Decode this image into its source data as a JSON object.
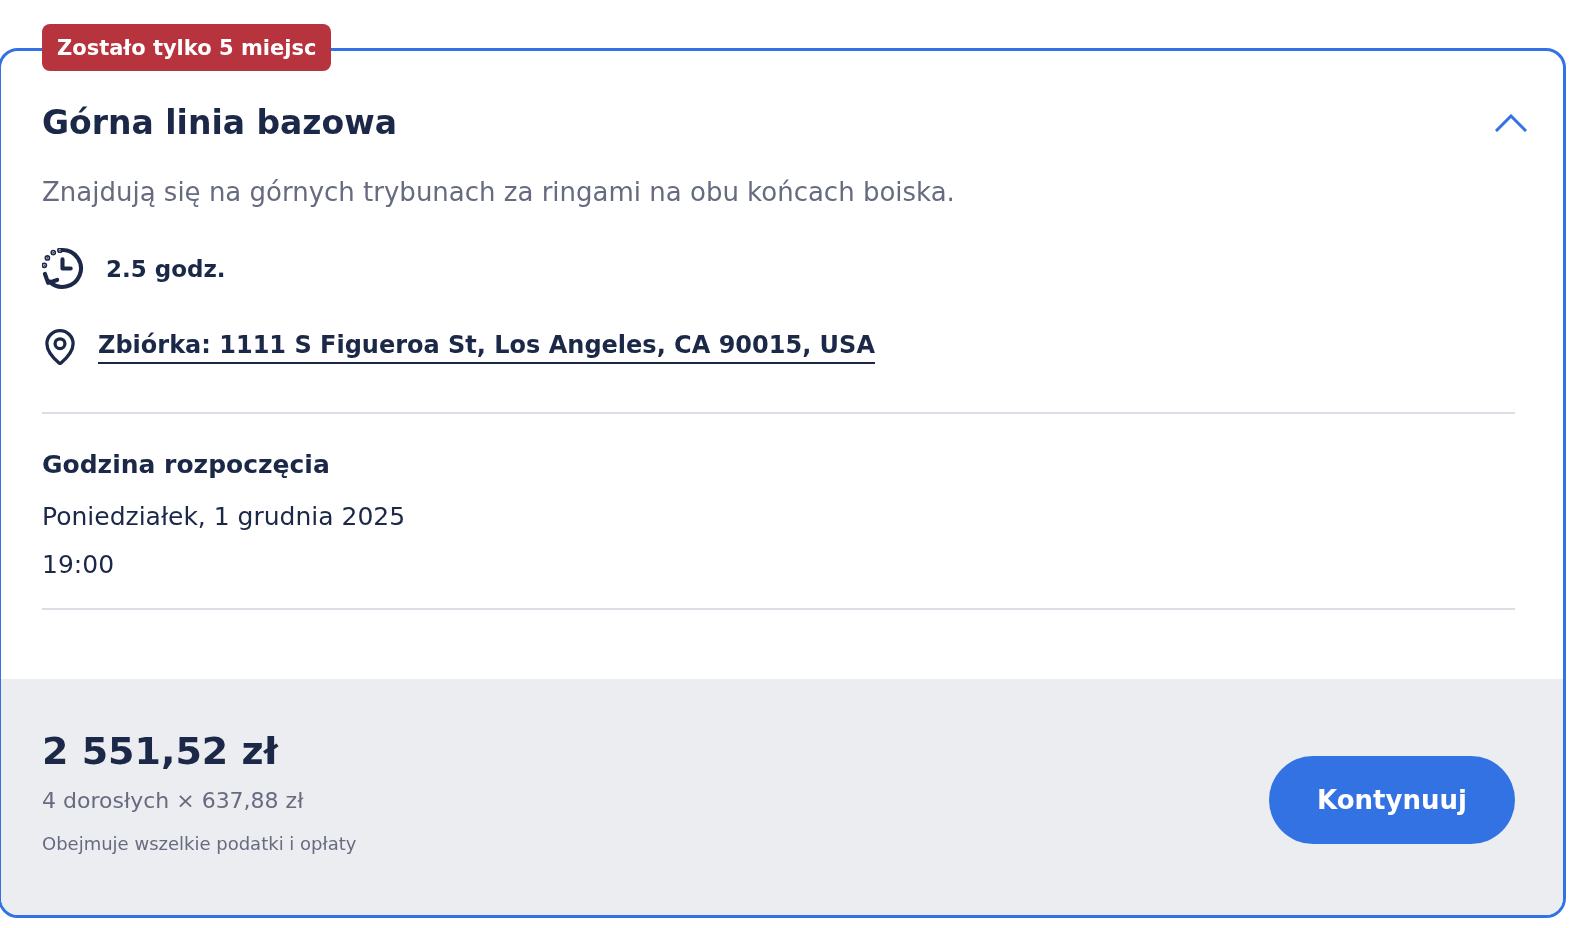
{
  "card": {
    "badge": "Zostało tylko 5 miejsc",
    "title": "Górna linia bazowa",
    "expanded": true,
    "description": "Znajdują się na górnych trybunach za ringami na obu końcach boiska.",
    "details": [
      {
        "kind": "duration",
        "text": "2.5 godz."
      },
      {
        "kind": "meeting_point",
        "text": "Zbiórka: 1111 S Figueroa St, Los Angeles, CA 90015, USA"
      }
    ],
    "start_time": {
      "heading": "Godzina rozpoczęcia",
      "date": "Poniedziałek, 1 grudnia 2025",
      "time": "19:00"
    }
  },
  "footer": {
    "price": "2 551,52 zł",
    "breakdown": "4 dorosłych × 637,88 zł",
    "note": "Obejmuje wszelkie podatki i opłaty",
    "button": "Kontynuuj"
  }
}
